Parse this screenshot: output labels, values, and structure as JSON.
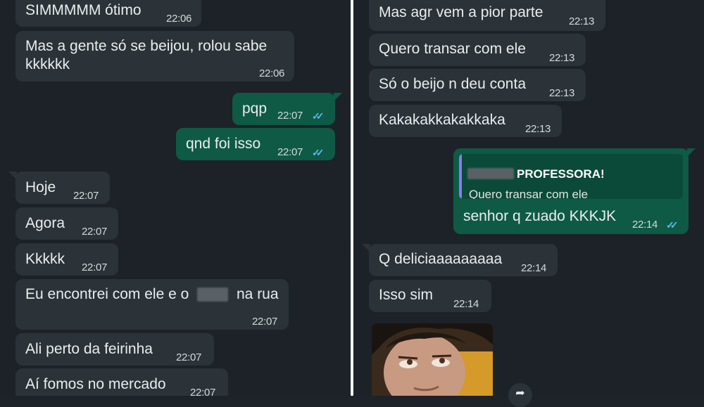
{
  "left_chat": {
    "messages": [
      {
        "dir": "in",
        "text": "SIMMMMM ótimo",
        "time": "22:06"
      },
      {
        "dir": "in",
        "line1": "Mas a gente só se beijou, rolou sabe",
        "line2": "kkkkkk",
        "time": "22:06"
      },
      {
        "dir": "out",
        "text": "pqp",
        "time": "22:07"
      },
      {
        "dir": "out",
        "text": "qnd foi isso",
        "time": "22:07"
      },
      {
        "dir": "in",
        "text": "Hoje",
        "time": "22:07"
      },
      {
        "dir": "in",
        "text": "Agora",
        "time": "22:07"
      },
      {
        "dir": "in",
        "text": "Kkkkk",
        "time": "22:07"
      },
      {
        "dir": "in",
        "text_before": "Eu encontrei com ele e o",
        "text_after": "na rua",
        "time": "22:07"
      },
      {
        "dir": "in",
        "text": "Ali perto da feirinha",
        "time": "22:07"
      },
      {
        "dir": "in",
        "text": "Aí fomos no mercado",
        "time": "22:07"
      }
    ]
  },
  "right_chat": {
    "messages": [
      {
        "dir": "in",
        "text": "Mas agr vem a pior parte",
        "time": "22:13"
      },
      {
        "dir": "in",
        "text": "Quero transar com ele",
        "time": "22:13"
      },
      {
        "dir": "in",
        "text": "Só o beijo n deu conta",
        "time": "22:13"
      },
      {
        "dir": "in",
        "text": "Kakakakkakakkaka",
        "time": "22:13"
      },
      {
        "dir": "out",
        "quote_author": "PROFESSORA!",
        "quote_text": "Quero transar com ele",
        "text": "senhor q zuado KKKJK",
        "time": "22:14"
      },
      {
        "dir": "in",
        "text": "Q deliciaaaaaaaaa",
        "time": "22:14"
      },
      {
        "dir": "in",
        "text": "Isso sim",
        "time": "22:14"
      }
    ]
  },
  "icons": {
    "read_ticks": "✓✓",
    "forward": "➦"
  },
  "colors": {
    "background": "#1c2227",
    "incoming": "#2b3338",
    "outgoing": "#0f5a45",
    "ticks": "#59b8f0"
  }
}
